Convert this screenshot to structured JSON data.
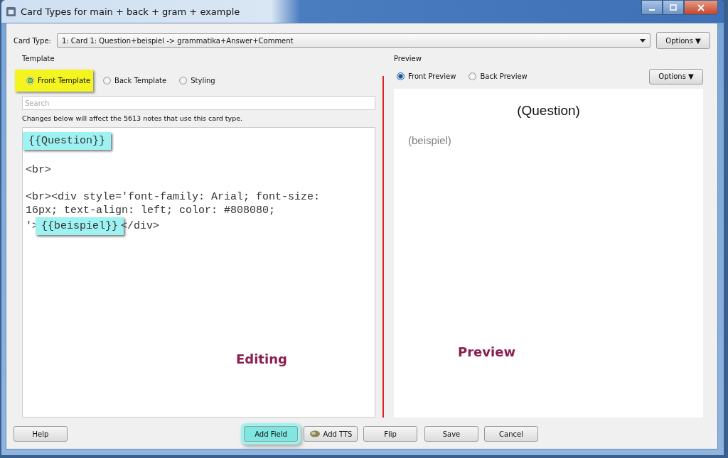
{
  "window": {
    "title": "Card Types for main + back + gram + example"
  },
  "card_type": {
    "label": "Card Type:",
    "value": "1: Card 1: Question+beispiel -> grammatika+Answer+Comment",
    "options_button": "Options ▼"
  },
  "template": {
    "title": "Template",
    "radios": [
      {
        "label": "Front Template",
        "selected": true,
        "highlighted": true
      },
      {
        "label": "Back Template",
        "selected": false,
        "highlighted": false
      },
      {
        "label": "Styling",
        "selected": false,
        "highlighted": false
      }
    ],
    "search": {
      "placeholder": "Search"
    },
    "notice": "Changes below will affect the 5613 notes that use this card type.",
    "code_lines": [
      {
        "blank_before": false,
        "segments": [
          {
            "text": "{{Question}}",
            "highlighted": true
          }
        ]
      },
      {
        "blank_before": true,
        "segments": [
          {
            "text": "<br>",
            "highlighted": false
          }
        ]
      },
      {
        "blank_before": true,
        "segments": [
          {
            "text": "<br><div style='font-family: Arial; font-size:",
            "highlighted": false
          }
        ]
      },
      {
        "blank_before": false,
        "segments": [
          {
            "text": "16px; text-align: left; color: #808080;",
            "highlighted": false
          }
        ]
      },
      {
        "blank_before": false,
        "segments": [
          {
            "text": "'>",
            "highlighted": false
          },
          {
            "text": "{{beispiel}}",
            "highlighted": true
          },
          {
            "text": "</div>",
            "highlighted": false
          }
        ]
      }
    ],
    "annotation": "Editing"
  },
  "preview": {
    "title": "Preview",
    "radios": [
      {
        "label": "Front Preview",
        "selected": true
      },
      {
        "label": "Back Preview",
        "selected": false
      }
    ],
    "options_button": "Options ▼",
    "question": "(Question)",
    "example": "(beispiel)",
    "annotation": "Preview"
  },
  "buttons": [
    {
      "label": "Help",
      "kind": "plain",
      "highlighted": false
    },
    {
      "label": "Add Field",
      "kind": "plain",
      "highlighted": true
    },
    {
      "label": "Add TTS",
      "kind": "tts",
      "highlighted": false
    },
    {
      "label": "Flip",
      "kind": "plain",
      "highlighted": false
    },
    {
      "label": "Save",
      "kind": "plain",
      "highlighted": false
    },
    {
      "label": "Cancel",
      "kind": "plain",
      "highlighted": false
    }
  ]
}
